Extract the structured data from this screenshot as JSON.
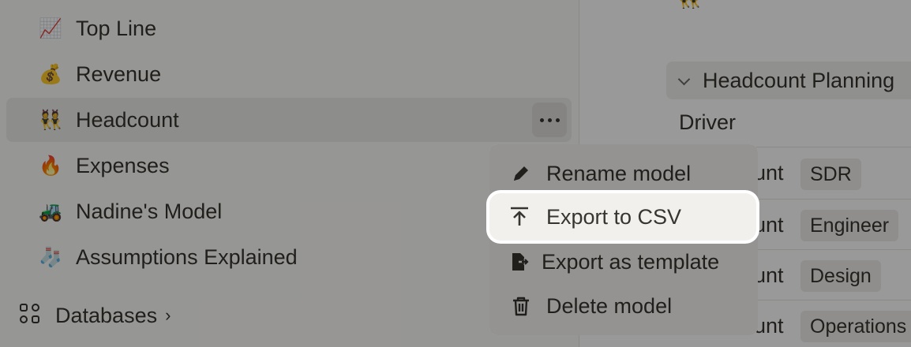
{
  "sidebar": {
    "items": [
      {
        "emoji": "📈",
        "label": "Top Line"
      },
      {
        "emoji": "💰",
        "label": "Revenue"
      },
      {
        "emoji": "👯",
        "label": "Headcount"
      },
      {
        "emoji": "🔥",
        "label": "Expenses"
      },
      {
        "emoji": "🚜",
        "label": "Nadine's Model"
      },
      {
        "emoji": "🧦",
        "label": "Assumptions Explained"
      }
    ],
    "active_item": "Headcount",
    "databases": {
      "label": "Databases",
      "chevron": "›"
    }
  },
  "main": {
    "top_emoji": "👯",
    "group": {
      "title": "Headcount Planning"
    },
    "driver_label": "Driver",
    "rows": [
      {
        "prefix": "ount",
        "tag": "SDR"
      },
      {
        "prefix": "ount",
        "tag": "Engineer"
      },
      {
        "prefix": "ount",
        "tag": "Design"
      },
      {
        "prefix": "ount",
        "tag": "Operations"
      }
    ]
  },
  "context_menu": {
    "items": [
      {
        "icon": "pencil-icon",
        "label": "Rename model"
      },
      {
        "icon": "upload-icon",
        "label": "Export to CSV"
      },
      {
        "icon": "file-export-icon",
        "label": "Export as template"
      },
      {
        "icon": "trash-icon",
        "label": "Delete model"
      }
    ],
    "highlighted": "Export to CSV"
  },
  "colors": {
    "overlay": "#000000",
    "menu_bg": "#f7f6f3",
    "highlight_ring": "#ffffff",
    "text": "#37352f"
  }
}
